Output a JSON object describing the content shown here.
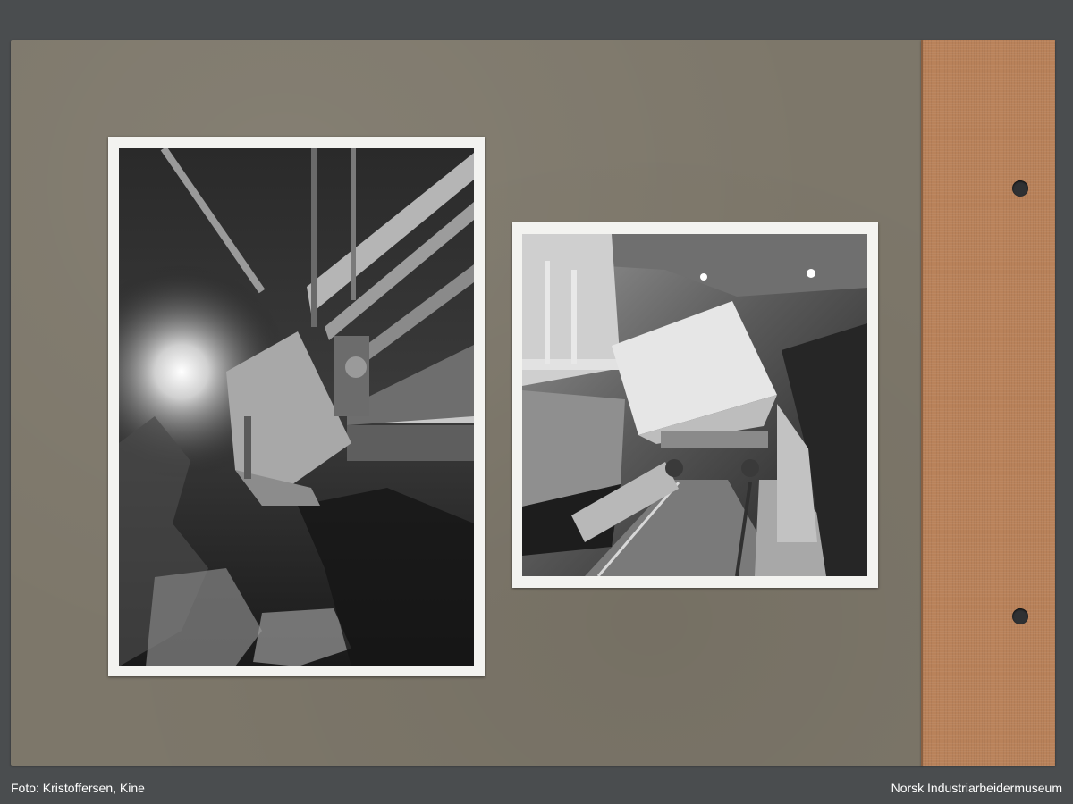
{
  "footer": {
    "photo_credit": "Foto: Kristoffersen, Kine",
    "museum": "Norsk Industriarbeidermuseum"
  },
  "album": {
    "board_color": "#7d776a",
    "spine_color": "#b9825a",
    "photos": [
      {
        "subject": "mine tunnel with tipping ore wagon on trestle"
      },
      {
        "subject": "tilted ore wagon on rail track in mine tunnel"
      }
    ]
  }
}
